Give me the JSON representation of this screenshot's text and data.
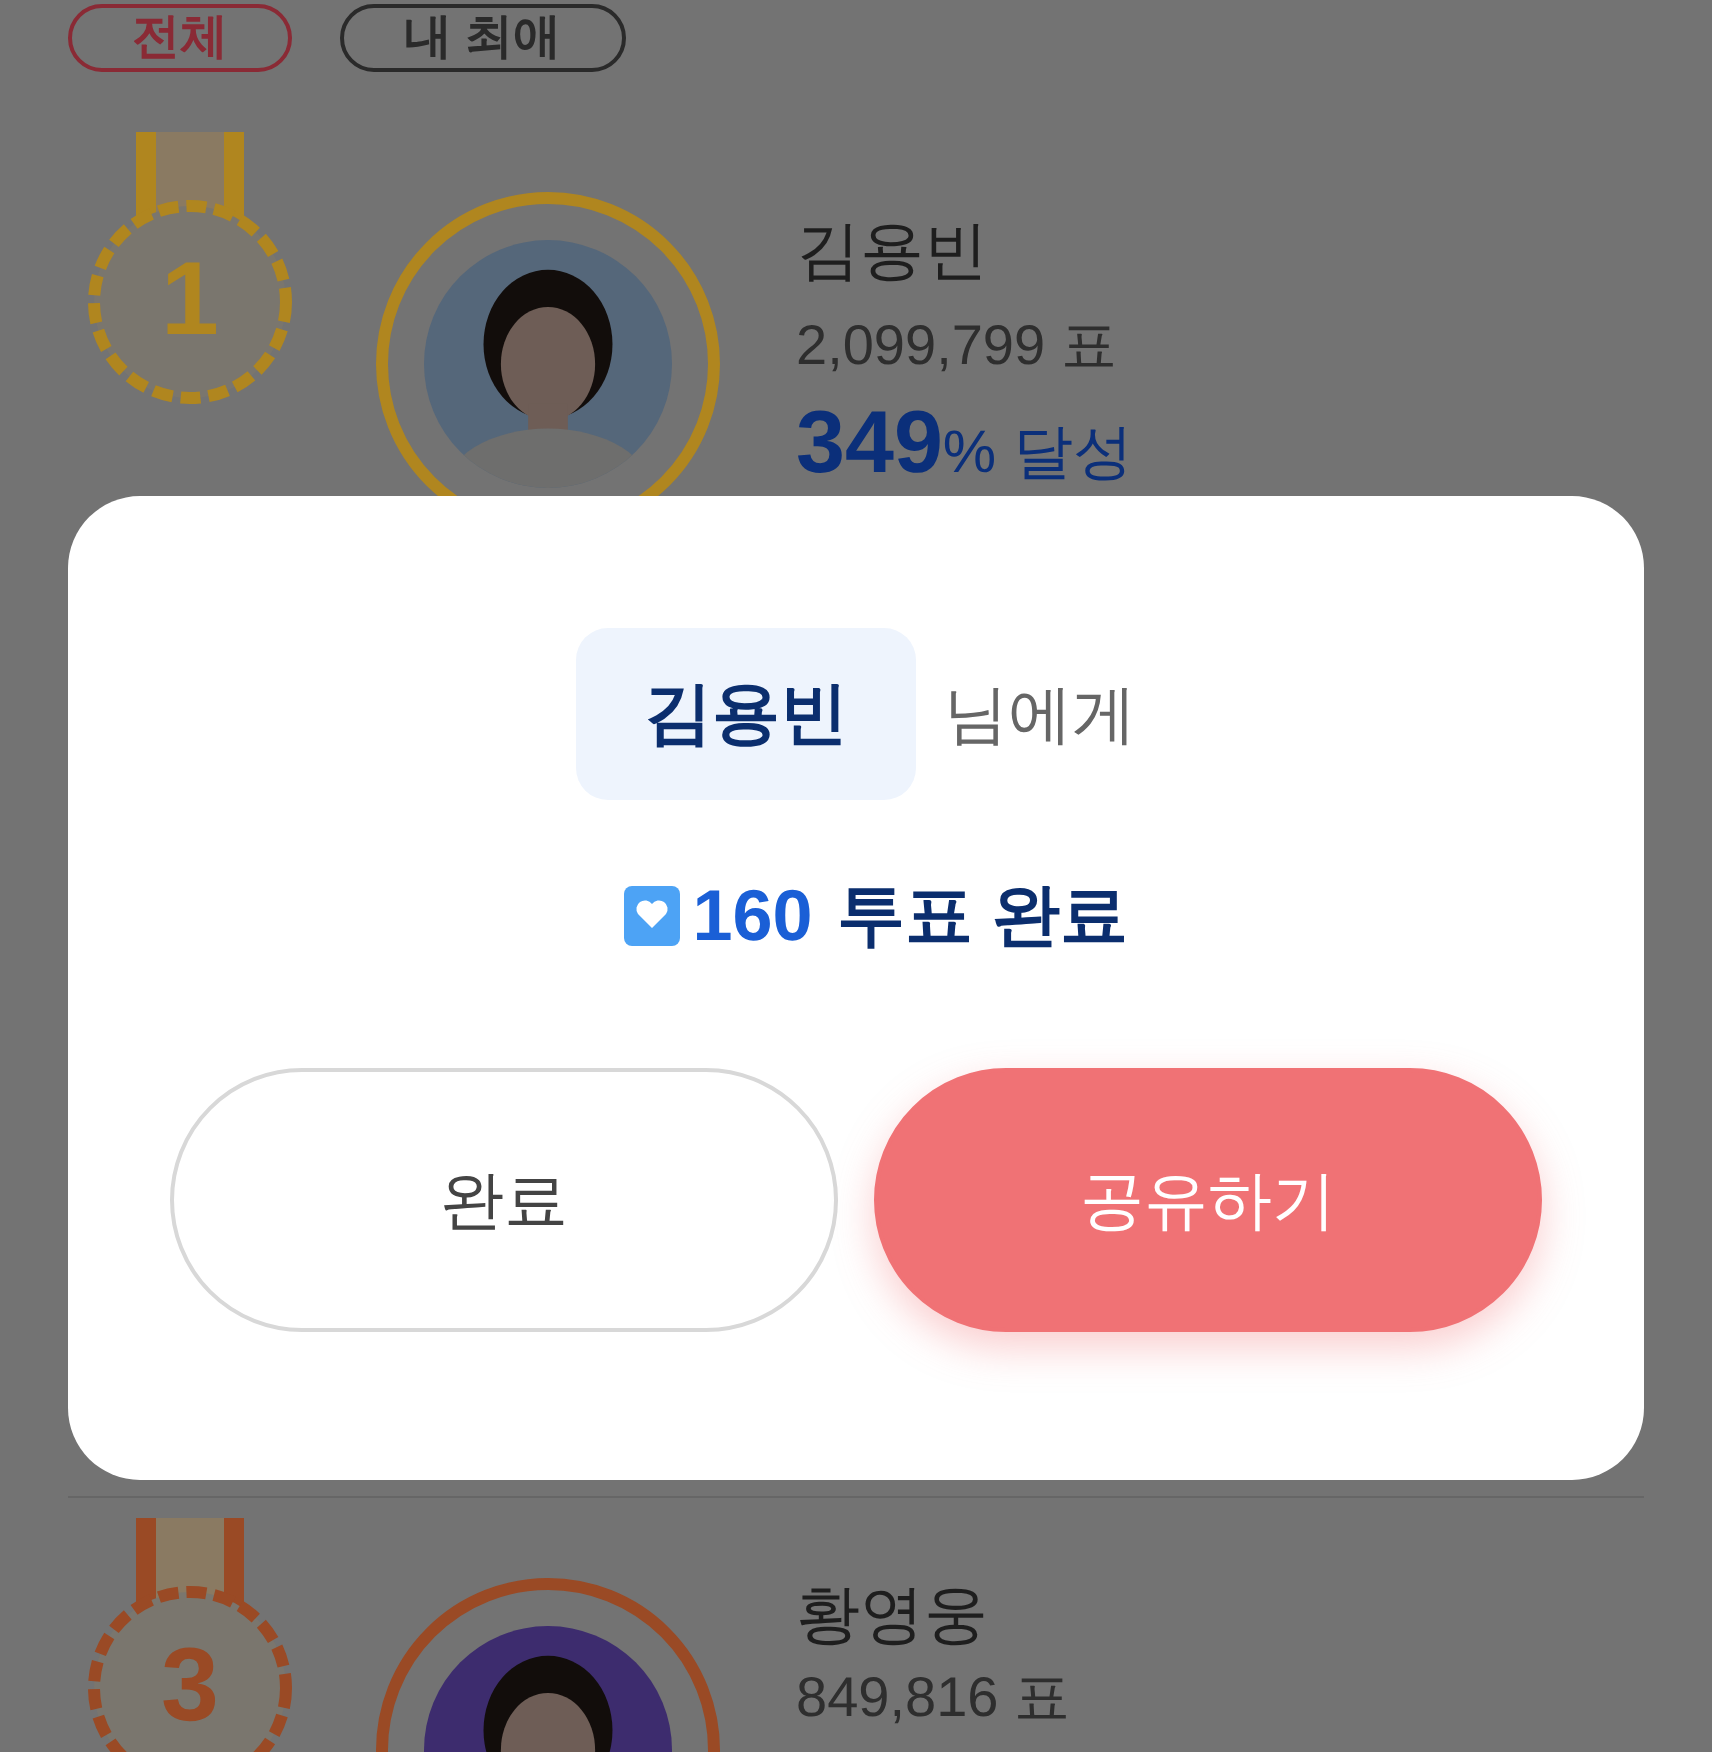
{
  "tabs": [
    {
      "label": "전체",
      "selected": true
    },
    {
      "label": "내 최애",
      "selected": false
    }
  ],
  "ranking": [
    {
      "rank": "1",
      "color": "#b0861f",
      "name": "김용빈",
      "votes": "2,099,799 표",
      "percent": "349",
      "percent_suffix": "% 달성"
    },
    {
      "rank": "3",
      "color": "#9a4a25",
      "name": "황영웅",
      "votes": "849,816 표"
    }
  ],
  "dialog": {
    "recipient": "김용빈",
    "recipient_suffix": "님에게",
    "vote_count": "160",
    "vote_text": "투표 완료",
    "buttons": [
      {
        "label": "완료",
        "kind": "secondary"
      },
      {
        "label": "공유하기",
        "kind": "primary"
      }
    ]
  }
}
